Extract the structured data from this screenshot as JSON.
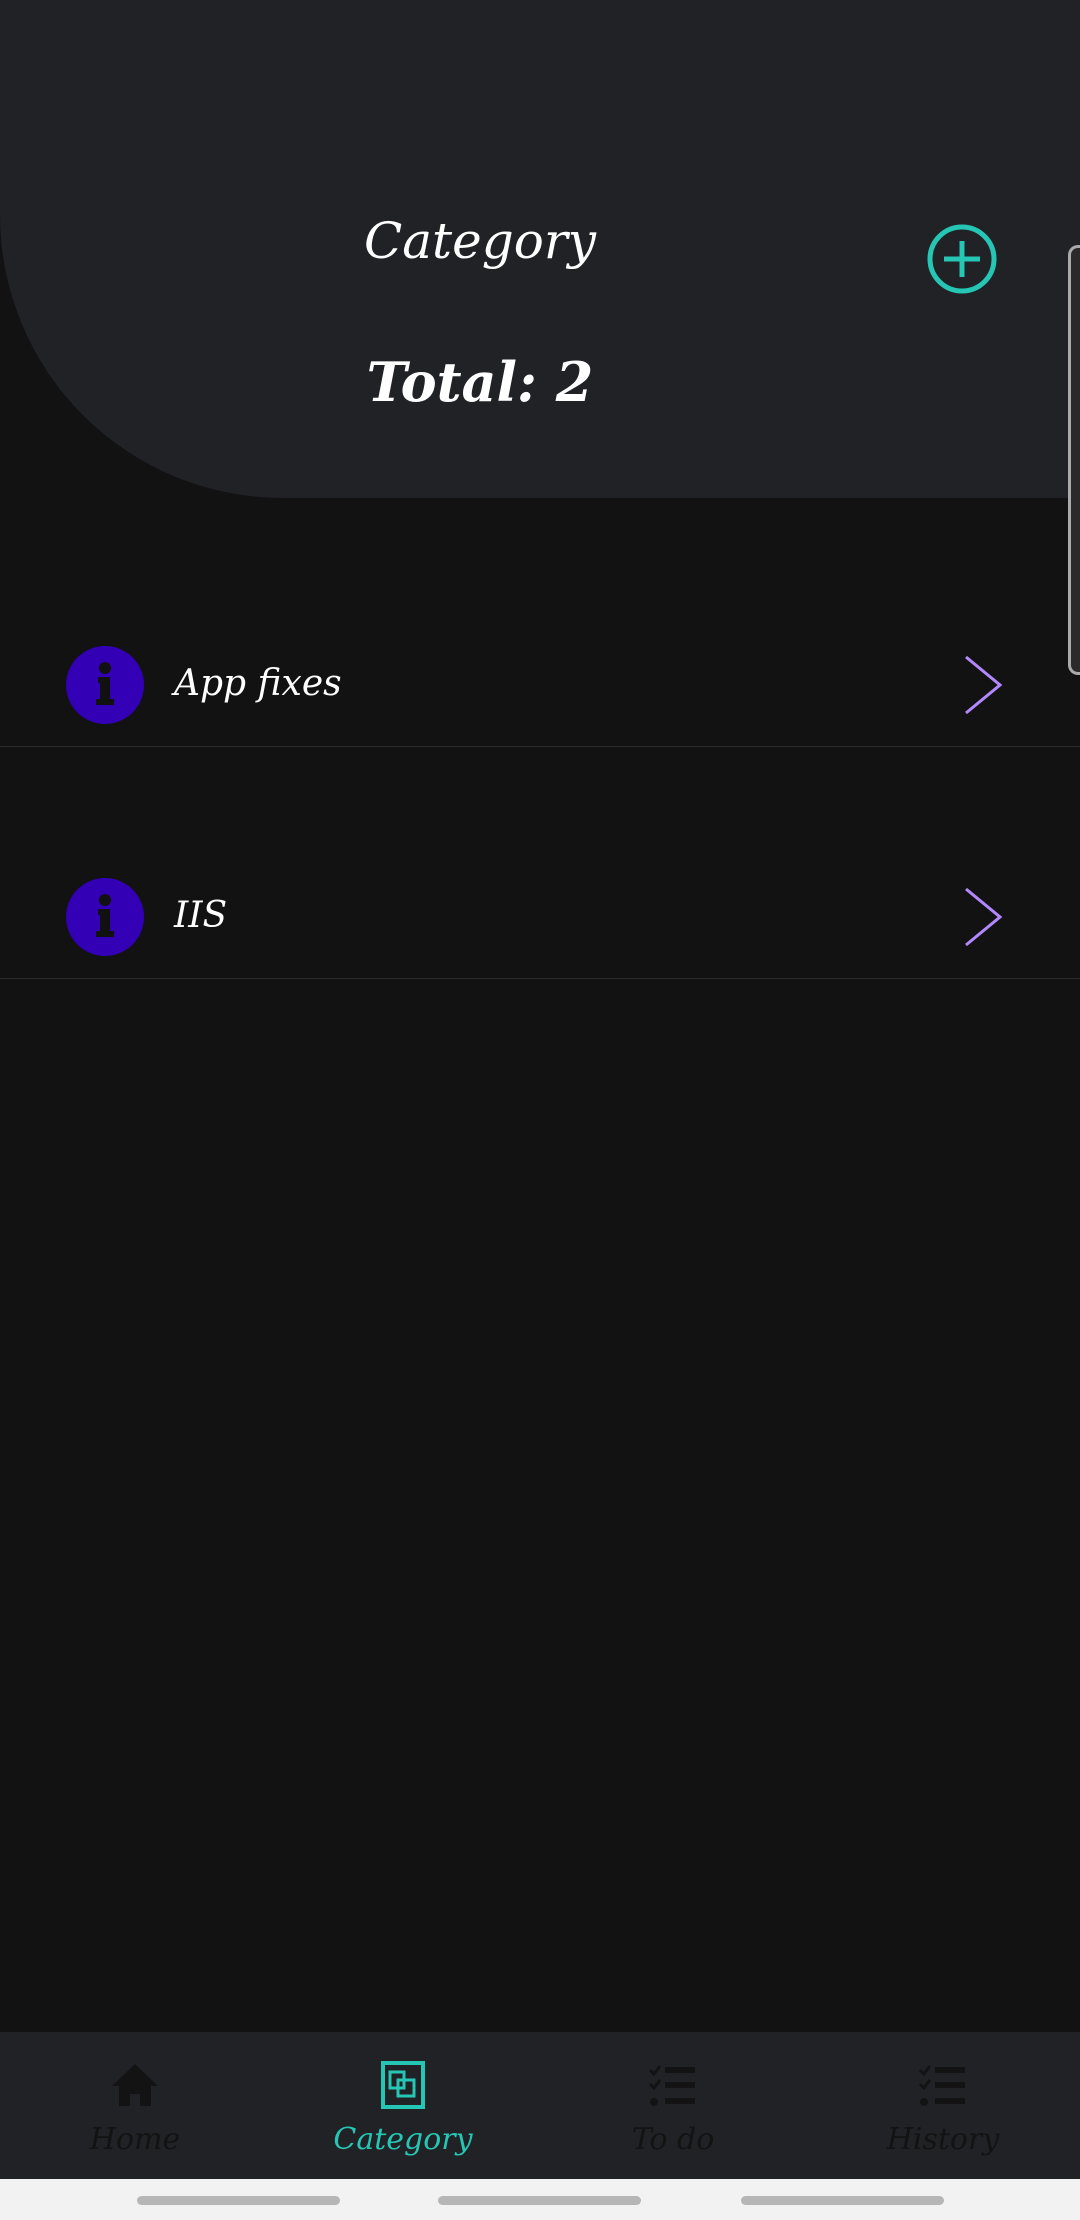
{
  "header": {
    "title": "Category",
    "total": "Total: 2"
  },
  "categories": [
    {
      "label": "App fixes"
    },
    {
      "label": "IIS"
    }
  ],
  "nav": [
    {
      "label": "Home"
    },
    {
      "label": "Category"
    },
    {
      "label": "To do"
    },
    {
      "label": "History"
    }
  ],
  "colors": {
    "accent": "#26c6b4",
    "icon_bg": "#3300b5",
    "chevron": "#b388ff"
  }
}
